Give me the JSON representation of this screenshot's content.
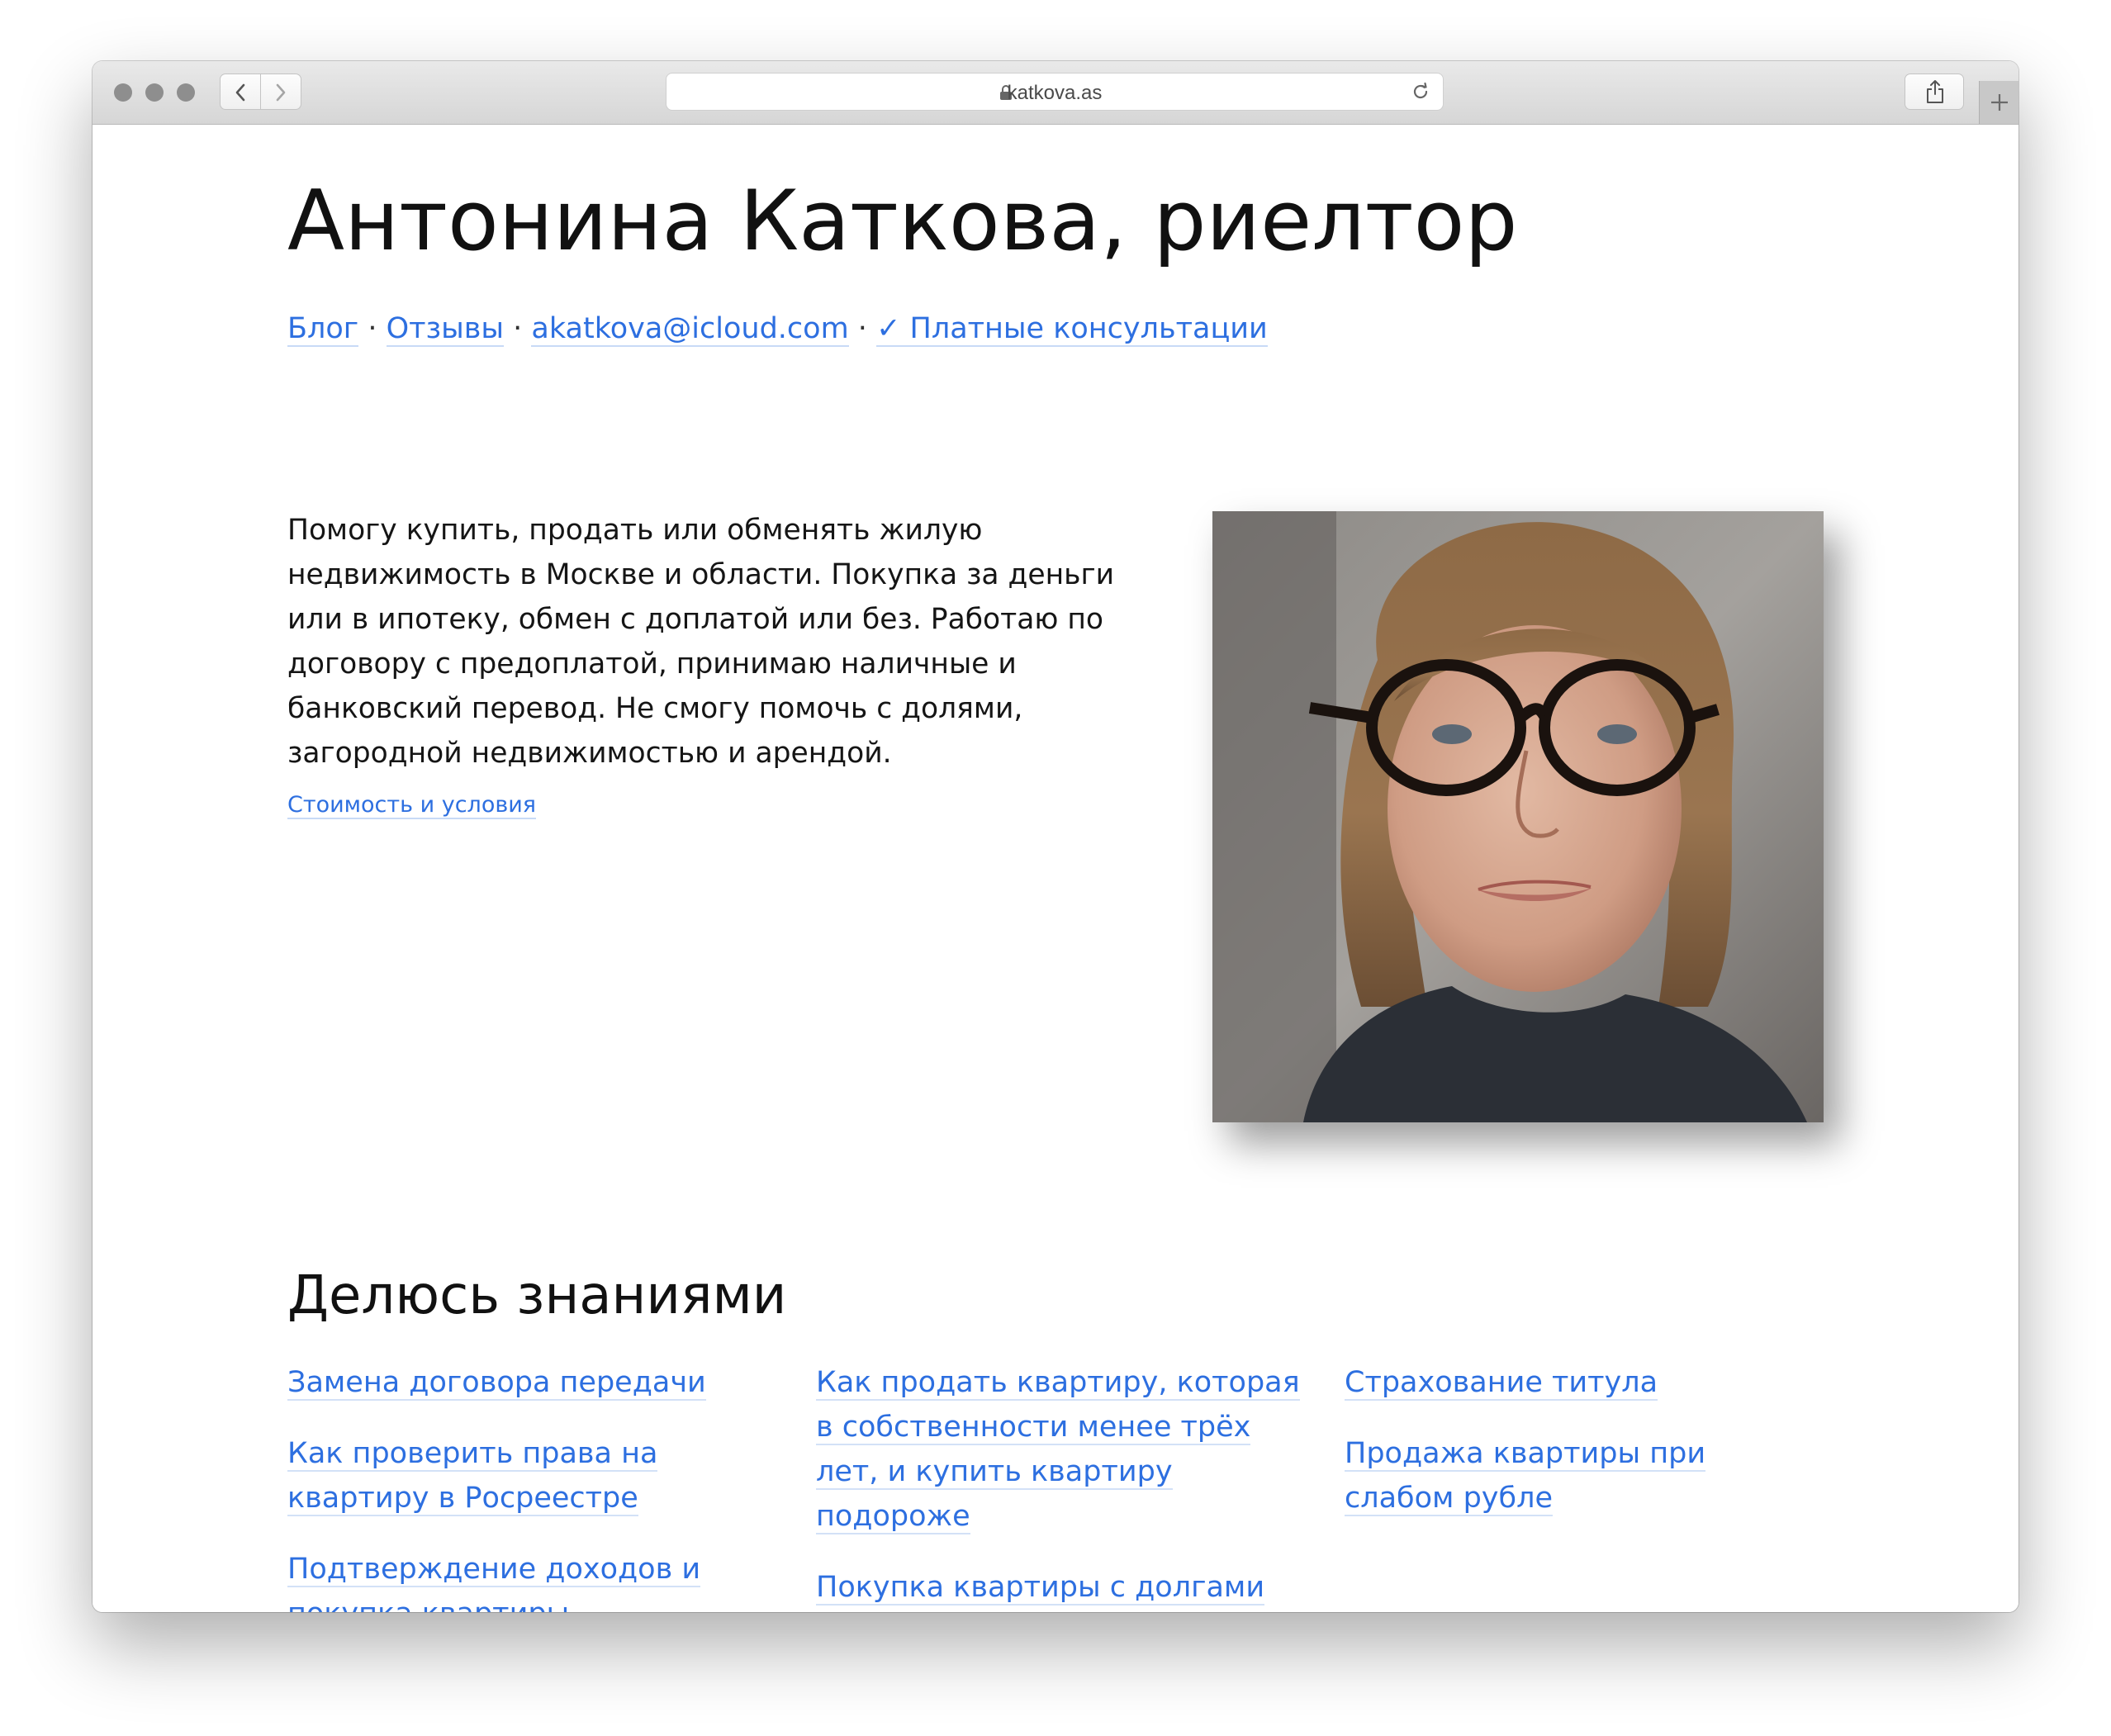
{
  "browser": {
    "url": "katkova.as",
    "lock_icon": "lock-icon",
    "reload_icon": "reload-icon",
    "share_icon": "share-icon",
    "new_tab_icon": "plus-icon"
  },
  "page": {
    "title": "Антонина Каткова, риелтор",
    "nav": {
      "blog": "Блог",
      "reviews": "Отзывы",
      "email": "akatkova@icloud.com",
      "separator": " · ",
      "consult": "✓ Платные консультации"
    },
    "intro": "Помогу купить, продать или обменять жилую недвижимость в Москве и области. Покупка за деньги или в ипотеку, обмен с доплатой или без. Работаю по договору с предоплатой, принимаю наличные и банковский перевод. Не смогу помочь с долями, загородной недвижимостью и арендой.",
    "conditions_link": "Стоимость и условия",
    "photo_alt": "Фото Антонины Катковой",
    "knowledge": {
      "title": "Делюсь знаниями",
      "col1": [
        "Замена договора передачи",
        "Как проверить права на квартиру в Росреестре",
        "Подтверждение доходов и покупка квартиры"
      ],
      "col2": [
        "Как продать квартиру, которая в собственности менее трёх лет, и купить квартиру подороже",
        "Покупка квартиры с долгами по коммуналке"
      ],
      "col3": [
        "Страхование титула",
        "Продажа квартиры при слабом рубле"
      ]
    }
  },
  "colors": {
    "link": "#2d6fe0",
    "text": "#111111"
  }
}
